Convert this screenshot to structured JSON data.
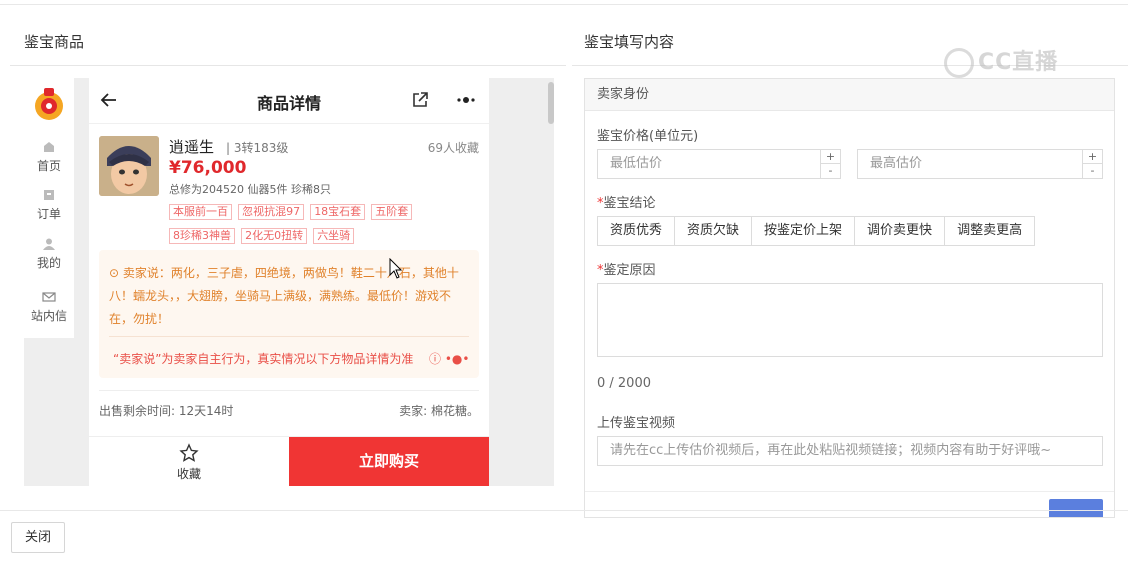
{
  "left_title": "鉴宝商品",
  "right_title": "鉴宝填写内容",
  "watermark": "CC直播",
  "side_nav": [
    {
      "label": "首页",
      "icon": "home-icon"
    },
    {
      "label": "订单",
      "icon": "order-icon"
    },
    {
      "label": "我的",
      "icon": "user-icon"
    },
    {
      "label": "站内信",
      "icon": "mail-icon"
    }
  ],
  "product": {
    "header_title": "商品详情",
    "seller_name": "逍遥生",
    "level": "3转183级",
    "favorites": "69人收藏",
    "price": "¥76,000",
    "stats": "总修为204520  仙器5件  珍稀8只",
    "tags": [
      "本服前一百",
      "忽视抗混97",
      "18宝石套",
      "五阶套",
      "8珍稀3神兽",
      "2化无0扭转",
      "六坐骑"
    ],
    "seller_says": "卖家说：两化，三子虐，四绝境，两做鸟！鞋二十八石，其他十八！蠕龙头，，大翅膀，坐骑马上满级，满熟练。最低价！游戏不在，勿扰！",
    "disclaimer": "“卖家说”为卖家自主行为，真实情况以下方物品详情为准",
    "remaining_time": "出售剩余时间: 12天14时",
    "seller_ref": "卖家: 棉花糖。",
    "collect_label": "收藏",
    "buy_label": "立即购买"
  },
  "form": {
    "section_head": "卖家身份",
    "price_label": "鉴宝价格(单位元)",
    "min_placeholder": "最低估价",
    "max_placeholder": "最高估价",
    "stepper_plus": "+",
    "stepper_minus": "-",
    "conclusion_label": "鉴宝结论",
    "conclusions": [
      "资质优秀",
      "资质欠缺",
      "按鉴定价上架",
      "调价卖更快",
      "调整卖更高"
    ],
    "reason_label": "鉴定原因",
    "char_count": "0 / 2000",
    "video_label": "上传鉴宝视频",
    "video_placeholder": "请先在cc上传估价视频后，再在此处粘贴视频链接；视频内容有助于好评哦~"
  },
  "close_label": "关闭"
}
